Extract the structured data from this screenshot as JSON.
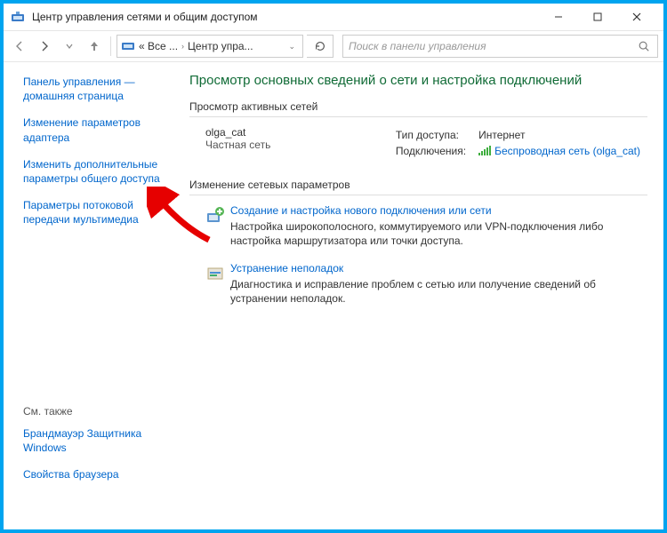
{
  "title": "Центр управления сетями и общим доступом",
  "breadcrumb": {
    "pre": "« Все ...",
    "cur": "Центр упра..."
  },
  "search": {
    "placeholder": "Поиск в панели управления"
  },
  "sidebar": {
    "items": [
      "Панель управления — домашняя страница",
      "Изменение параметров адаптера",
      "Изменить дополнительные параметры общего доступа",
      "Параметры потоковой передачи мультимедиа"
    ],
    "see_also_hdr": "См. также",
    "see_also": [
      "Брандмауэр Защитника Windows",
      "Свойства браузера"
    ]
  },
  "main": {
    "heading": "Просмотр основных сведений о сети и настройка подключений",
    "active_hdr": "Просмотр активных сетей",
    "net": {
      "name": "olga_cat",
      "type": "Частная сеть",
      "access_lbl": "Тип доступа:",
      "access_val": "Интернет",
      "conn_lbl": "Подключения:",
      "conn_val": "Беспроводная сеть (olga_cat)"
    },
    "change_hdr": "Изменение сетевых параметров",
    "opts": [
      {
        "link": "Создание и настройка нового подключения или сети",
        "desc": "Настройка широкополосного, коммутируемого или VPN-подключения либо настройка маршрутизатора или точки доступа."
      },
      {
        "link": "Устранение неполадок",
        "desc": "Диагностика и исправление проблем с сетью или получение сведений об устранении неполадок."
      }
    ]
  }
}
